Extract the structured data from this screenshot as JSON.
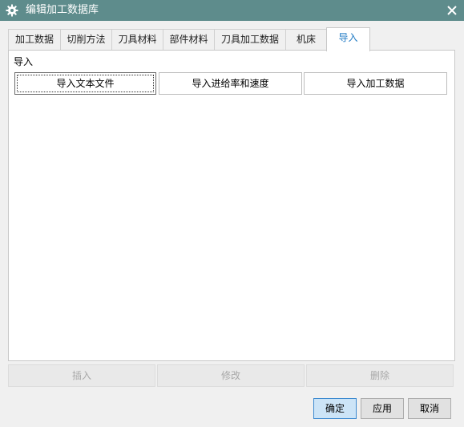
{
  "window": {
    "title": "编辑加工数据库"
  },
  "tabs": [
    {
      "label": "加工数据"
    },
    {
      "label": "切削方法"
    },
    {
      "label": "刀具材料"
    },
    {
      "label": "部件材料"
    },
    {
      "label": "刀具加工数据"
    },
    {
      "label": "机床"
    },
    {
      "label": "导入",
      "active": true
    }
  ],
  "import_section": {
    "label": "导入",
    "buttons": [
      {
        "label": "导入文本文件"
      },
      {
        "label": "导入进给率和速度"
      },
      {
        "label": "导入加工数据"
      }
    ]
  },
  "actions": {
    "insert": "插入",
    "modify": "修改",
    "delete": "删除"
  },
  "dialog_buttons": {
    "ok": "确定",
    "apply": "应用",
    "cancel": "取消"
  },
  "colors": {
    "titlebar": "#5e8c8c",
    "active_tab_text": "#1f7ac4",
    "primary_button": "#cce4f7"
  },
  "icons": {
    "app": "gear-icon",
    "close": "close-icon"
  }
}
